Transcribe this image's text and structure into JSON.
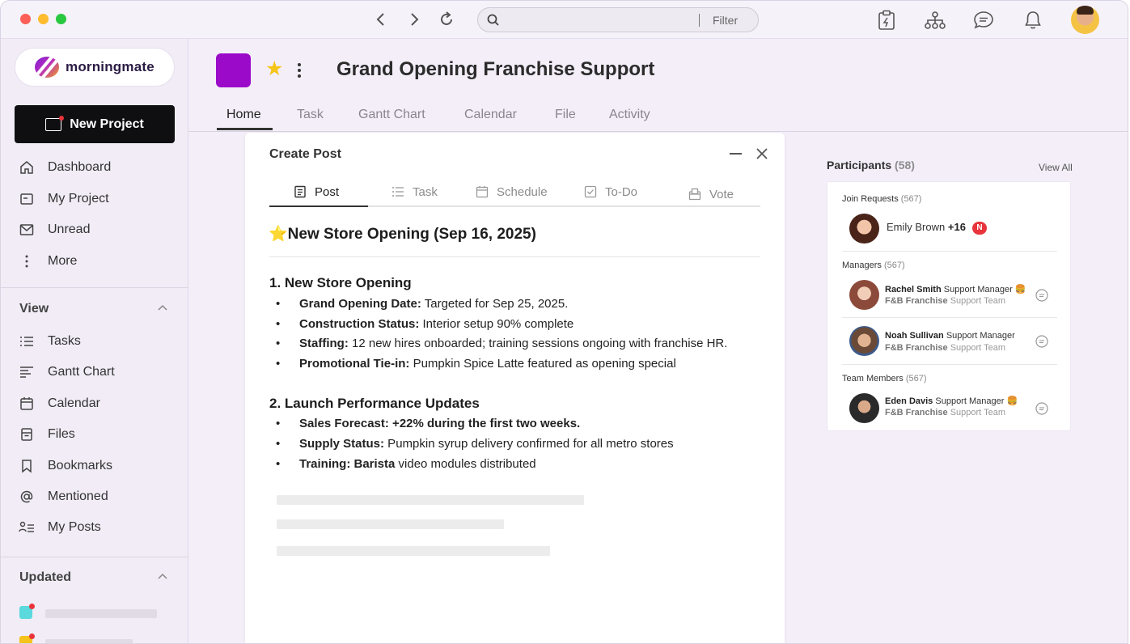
{
  "browser": {
    "search_placeholder": "",
    "filter_label": "Filter"
  },
  "sidebar": {
    "logo_text": "morningmate",
    "new_project_label": "New Project",
    "nav": [
      {
        "label": "Dashboard",
        "icon": "home-icon"
      },
      {
        "label": "My Project",
        "icon": "project-icon"
      },
      {
        "label": "Unread",
        "icon": "mail-icon"
      },
      {
        "label": "More",
        "icon": "more-vertical-icon"
      }
    ],
    "view_section": "View",
    "view_items": [
      {
        "label": "Tasks",
        "icon": "list-icon"
      },
      {
        "label": "Gantt Chart",
        "icon": "gantt-icon"
      },
      {
        "label": "Calendar",
        "icon": "calendar-icon"
      },
      {
        "label": "Files",
        "icon": "file-icon"
      },
      {
        "label": "Bookmarks",
        "icon": "bookmark-icon"
      },
      {
        "label": "Mentioned",
        "icon": "at-icon"
      },
      {
        "label": "My Posts",
        "icon": "user-list-icon"
      }
    ],
    "updated_section": "Updated",
    "updated_colors": [
      "#5bd9dc",
      "#f6c21c"
    ]
  },
  "project": {
    "title": "Grand Opening Franchise Support",
    "color": "#9b0ac9",
    "tabs": [
      "Home",
      "Task",
      "Gantt Chart",
      "Calendar",
      "File",
      "Activity"
    ],
    "active_tab": "Home"
  },
  "create_post": {
    "title": "Create Post",
    "tabs": [
      "Post",
      "Task",
      "Schedule",
      "To-Do",
      "Vote"
    ],
    "active_tab": "Post",
    "heading": "⭐New Store Opening (Sep 16, 2025)",
    "sections": [
      {
        "title": "1. New Store Opening",
        "bullets": [
          {
            "bold": "Grand Opening Date:",
            "text": " Targeted for Sep 25, 2025."
          },
          {
            "bold": "Construction Status:",
            "text": " Interior setup 90% complete"
          },
          {
            "bold": "Staffing:",
            "text": " 12 new hires onboarded; training sessions ongoing with franchise HR."
          },
          {
            "bold": "Promotional Tie-in:",
            "text": " Pumpkin Spice Latte featured as opening special"
          }
        ]
      },
      {
        "title": "2. Launch Performance Updates",
        "bullets": [
          {
            "bold": "Sales Forecast: +22% during the first two weeks.",
            "text": ""
          },
          {
            "bold": "Supply Status:",
            "text": " Pumpkin syrup delivery confirmed for all metro stores"
          },
          {
            "bold": "Training: Barista",
            "text": " video modules distributed"
          }
        ]
      }
    ]
  },
  "participants": {
    "title": "Participants",
    "count": "(58)",
    "view_all": "View All",
    "join_requests": {
      "label": "Join Requests",
      "count": "(567)",
      "name": "Emily Brown",
      "extra": "+16",
      "badge": "N"
    },
    "managers": {
      "label": "Managers",
      "count": "(567)",
      "people": [
        {
          "name": "Rachel Smith",
          "role": "Support Manager",
          "emoji": "🍔",
          "org": "F&B Franchise",
          "team": "Support Team"
        },
        {
          "name": "Noah Sullivan",
          "role": "Support Manager",
          "emoji": "",
          "org": "F&B Franchise",
          "team": "Support Team"
        }
      ]
    },
    "team_members": {
      "label": "Team Members",
      "count": "(567)",
      "people": [
        {
          "name": "Eden Davis",
          "role": "Support Manager",
          "emoji": "🍔",
          "org": "F&B Franchise",
          "team": "Support Team"
        }
      ]
    }
  }
}
